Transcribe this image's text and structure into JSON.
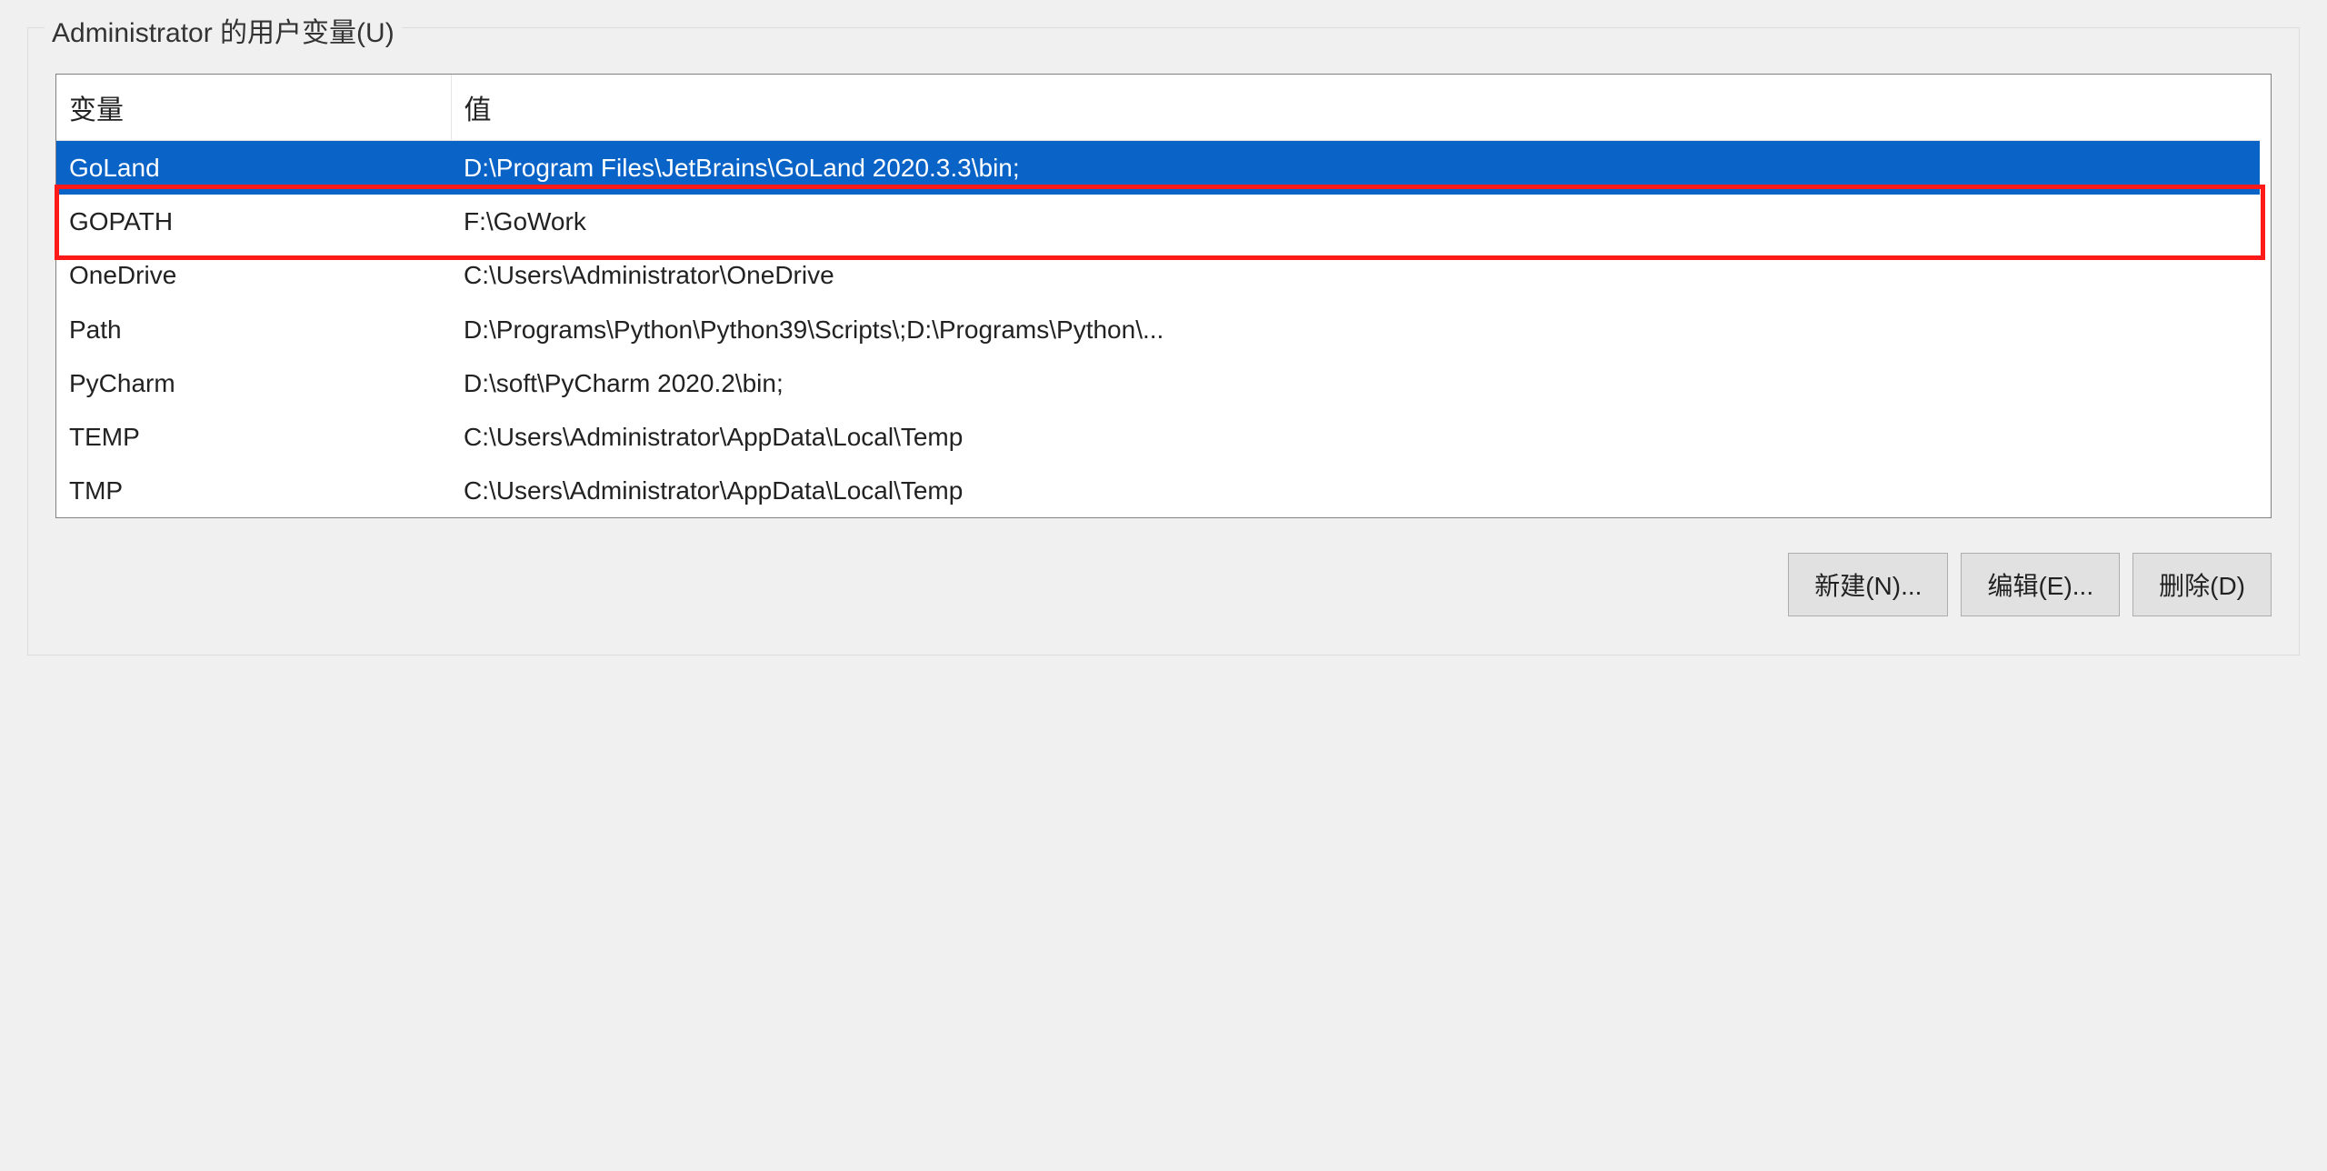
{
  "group": {
    "legend": "Administrator 的用户变量(U)"
  },
  "table": {
    "headers": {
      "variable": "变量",
      "value": "值"
    },
    "rows": [
      {
        "variable": "GoLand",
        "value": "D:\\Program Files\\JetBrains\\GoLand 2020.3.3\\bin;",
        "selected": true,
        "highlighted": false
      },
      {
        "variable": "GOPATH",
        "value": "F:\\GoWork",
        "selected": false,
        "highlighted": true
      },
      {
        "variable": "OneDrive",
        "value": "C:\\Users\\Administrator\\OneDrive",
        "selected": false,
        "highlighted": false
      },
      {
        "variable": "Path",
        "value": "D:\\Programs\\Python\\Python39\\Scripts\\;D:\\Programs\\Python\\...",
        "selected": false,
        "highlighted": false
      },
      {
        "variable": "PyCharm",
        "value": "D:\\soft\\PyCharm 2020.2\\bin;",
        "selected": false,
        "highlighted": false
      },
      {
        "variable": "TEMP",
        "value": "C:\\Users\\Administrator\\AppData\\Local\\Temp",
        "selected": false,
        "highlighted": false
      },
      {
        "variable": "TMP",
        "value": "C:\\Users\\Administrator\\AppData\\Local\\Temp",
        "selected": false,
        "highlighted": false
      }
    ]
  },
  "buttons": {
    "new": "新建(N)...",
    "edit": "编辑(E)...",
    "delete": "删除(D)"
  }
}
